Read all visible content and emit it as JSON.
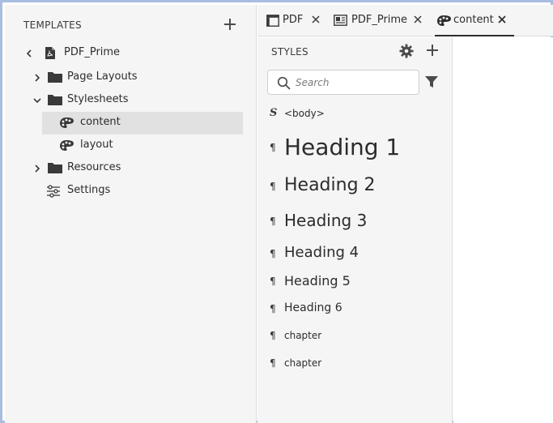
{
  "templates_panel": {
    "title": "TEMPLATES",
    "add_icon": "plus-icon",
    "tree": [
      {
        "label": "PDF_Prime",
        "icon": "pdf-file-icon",
        "chevron": "chevron-left"
      },
      {
        "label": "Page Layouts",
        "icon": "folder-icon",
        "chevron": "chevron-right"
      },
      {
        "label": "Stylesheets",
        "icon": "folder-icon",
        "chevron": "chevron-down"
      },
      {
        "label": "content",
        "icon": "palette-icon",
        "selected": true
      },
      {
        "label": "layout",
        "icon": "palette-icon"
      },
      {
        "label": "Resources",
        "icon": "folder-icon",
        "chevron": "chevron-right"
      },
      {
        "label": "Settings",
        "icon": "sliders-icon"
      }
    ]
  },
  "tabs": [
    {
      "label": "PDF",
      "icon": "window-icon"
    },
    {
      "label": "PDF_Prime",
      "icon": "layout-icon"
    },
    {
      "label": "content",
      "icon": "palette-icon",
      "active": true
    }
  ],
  "styles_panel": {
    "title": "STYLES",
    "settings_icon": "gear-icon",
    "add_icon": "plus-icon",
    "search": {
      "placeholder": "Search",
      "value": ""
    },
    "filter_icon": "filter-icon",
    "items": [
      {
        "mark": "S",
        "label": "<body>"
      },
      {
        "mark": "¶",
        "label": "Heading 1"
      },
      {
        "mark": "¶",
        "label": "Heading 2"
      },
      {
        "mark": "¶",
        "label": "Heading 3"
      },
      {
        "mark": "¶",
        "label": "Heading 4"
      },
      {
        "mark": "¶",
        "label": "Heading 5"
      },
      {
        "mark": "¶",
        "label": "Heading 6"
      },
      {
        "mark": "¶",
        "label": "chapter"
      },
      {
        "mark": "¶",
        "label": "chapter"
      }
    ]
  },
  "colors": {
    "panel_bg": "#f5f5f5",
    "selected_bg": "#e1e1e1",
    "frame_border": "#a9bde0",
    "text": "#2c2c2c"
  }
}
